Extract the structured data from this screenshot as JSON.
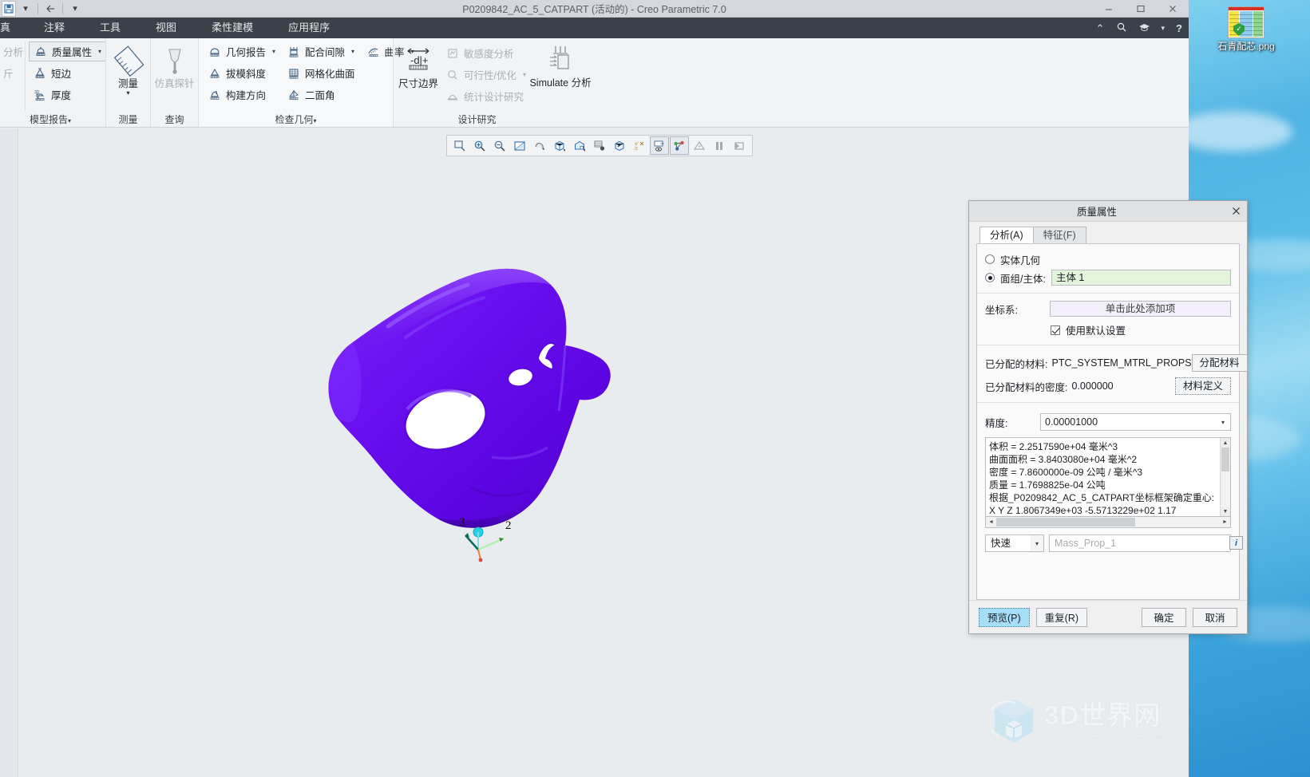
{
  "window": {
    "title": "P0209842_AC_5_CATPART (活动的) - Creo Parametric 7.0",
    "minimize": "–",
    "maximize": "▢",
    "close": "✕"
  },
  "quick_access": {
    "items": [
      "save-icon",
      "dropdown-caret",
      "undo-icon",
      "customize-caret"
    ]
  },
  "ribbon_tabs": {
    "items": [
      {
        "label": "真",
        "name": "tab-simulate"
      },
      {
        "label": "注释",
        "name": "tab-annotate"
      },
      {
        "label": "工具",
        "name": "tab-tools"
      },
      {
        "label": "视图",
        "name": "tab-view"
      },
      {
        "label": "柔性建模",
        "name": "tab-flexible-modeling"
      },
      {
        "label": "应用程序",
        "name": "tab-applications"
      }
    ],
    "right_icons": [
      "collapse-ribbon-caret",
      "search-icon",
      "learning-icon",
      "dropdown-caret",
      "help-icon"
    ]
  },
  "ribbon": {
    "groups": [
      {
        "name": "model-report",
        "label": "模型报告",
        "label_caret": "▾",
        "items": [
          {
            "label": "分析",
            "icon": "analysis-icon",
            "disabled": true
          },
          {
            "label": "斤",
            "icon": "measure-icon",
            "disabled": true
          },
          {
            "label": "质量属性",
            "icon": "mass-properties-icon",
            "caret": "▾",
            "selected": true
          },
          {
            "label": "短边",
            "icon": "short-edge-icon"
          },
          {
            "label": "厚度",
            "icon": "thickness-icon"
          }
        ]
      },
      {
        "name": "measure",
        "label": "测量",
        "big": {
          "label": "测量",
          "icon": "ruler-icon",
          "caret": "▾"
        }
      },
      {
        "name": "inquiry",
        "label": "查询",
        "big": {
          "label": "仿真探针",
          "icon": "simulation-probe-icon",
          "disabled": true
        }
      },
      {
        "name": "inspect-geometry",
        "label": "检查几何",
        "label_caret": "▾",
        "items": [
          {
            "label": "几何报告",
            "icon": "geometry-report-icon",
            "caret": "▾"
          },
          {
            "label": "配合间隙",
            "icon": "fit-clearance-icon",
            "caret": "▾"
          },
          {
            "label": "曲率",
            "icon": "curvature-icon",
            "caret": "▾"
          },
          {
            "label": "拔模斜度",
            "icon": "draft-angle-icon"
          },
          {
            "label": "网格化曲面",
            "icon": "mesh-surface-icon"
          },
          {
            "label": "构建方向",
            "icon": "build-direction-icon"
          },
          {
            "label": "二面角",
            "icon": "dihedral-angle-icon"
          }
        ]
      },
      {
        "name": "design-study",
        "label": "设计研究",
        "items": [
          {
            "label": "尺寸边界",
            "icon": "dimension-bounds-icon",
            "big": true
          },
          {
            "label": "敏感度分析",
            "icon": "sensitivity-analysis-icon",
            "disabled": true
          },
          {
            "label": "可行性/优化",
            "icon": "feasibility-optimization-icon",
            "caret": "▾",
            "disabled": true
          },
          {
            "label": "统计设计研究",
            "icon": "statistical-design-study-icon",
            "disabled": true
          },
          {
            "label": "Simulate 分析",
            "icon": "simulate-analysis-icon",
            "big": true
          }
        ]
      }
    ]
  },
  "graphics_toolbar": {
    "buttons": [
      {
        "name": "zoom-to-fit-icon",
        "glyph": "zoom-box"
      },
      {
        "name": "zoom-in-icon",
        "glyph": "zoom-plus"
      },
      {
        "name": "zoom-out-icon",
        "glyph": "zoom-minus"
      },
      {
        "name": "repaint-icon",
        "glyph": "repaint"
      },
      {
        "name": "saved-orientations-icon",
        "glyph": "orient"
      },
      {
        "name": "display-style-icon",
        "glyph": "cube"
      },
      {
        "name": "perspective-view-icon",
        "glyph": "persp"
      },
      {
        "name": "view-manager-icon",
        "glyph": "viewmgr"
      },
      {
        "name": "appearance-gallery-icon",
        "glyph": "appear"
      },
      {
        "name": "datum-display-filters-icon",
        "glyph": "datum"
      },
      {
        "name": "annotation-display-icon",
        "glyph": "annot",
        "active": true
      },
      {
        "name": "spin-center-icon",
        "glyph": "spin",
        "active": true
      },
      {
        "name": "layer-icon",
        "glyph": "layer",
        "disabled": true
      },
      {
        "name": "pause-icon",
        "glyph": "pause",
        "disabled": true
      },
      {
        "name": "stop-icon",
        "glyph": "stop",
        "disabled": true
      }
    ]
  },
  "model": {
    "color": "#6f12f0",
    "triad_labels": [
      "3",
      "2"
    ],
    "name": "csys-triad"
  },
  "dialog": {
    "title": "质量属性",
    "close": "✕",
    "tabs": [
      {
        "label": "分析(A)",
        "active": true,
        "name": "tab-analysis"
      },
      {
        "label": "特征(F)",
        "active": false,
        "name": "tab-feature"
      }
    ],
    "geometry": {
      "solid_label": "实体几何",
      "solid_selected": false,
      "quilt_label": "面组/主体:",
      "quilt_selected": true,
      "quilt_value": "主体 1"
    },
    "csys": {
      "label": "坐标系:",
      "placeholder": "单击此处添加项",
      "use_default_label": "使用默认设置",
      "use_default_checked": true
    },
    "material": {
      "assigned_label": "已分配的材料:",
      "assigned_value": "PTC_SYSTEM_MTRL_PROPS",
      "assign_button": "分配材料",
      "density_label": "已分配材料的密度:",
      "density_value": "0.000000",
      "define_button": "材料定义"
    },
    "accuracy": {
      "label": "精度:",
      "value": "0.00001000",
      "caret": "▾"
    },
    "results": {
      "lines": [
        "体积 =  2.2517590e+04  毫米^3",
        "曲面面积 =  3.8403080e+04  毫米^2",
        "密度 =  7.8600000e-09 公吨 / 毫米^3",
        "质量 =  1.7698825e-04 公吨",
        "根据_P0209842_AC_5_CATPART坐标框架确定重心:",
        "X  Y  Z    1.8067349e+03 -5.5713229e+02  1.17"
      ],
      "scroll_up": "▲",
      "scroll_down": "▼",
      "scroll_left": "◄",
      "scroll_right": "►"
    },
    "bottom": {
      "mode_value": "快速",
      "mode_caret": "▾",
      "name_placeholder": "Mass_Prop_1",
      "info_glyph": "i"
    },
    "footer": {
      "preview": "预览(P)",
      "repeat": "重复(R)",
      "ok": "确定",
      "cancel": "取消"
    }
  },
  "desktop": {
    "icon_label": "石青配芯.png"
  },
  "watermark": {
    "main": "3D世界网",
    "sub": "WWW.SDSJW.COM"
  }
}
